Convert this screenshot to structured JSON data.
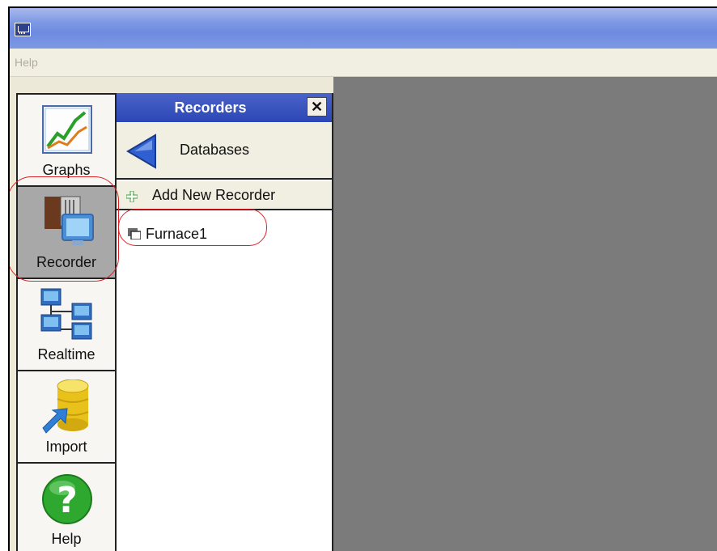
{
  "window": {
    "icon": "app-icon"
  },
  "menubar": {
    "items": [
      {
        "label": "Help"
      }
    ]
  },
  "toolbar": {
    "buttons": [
      {
        "label": "Graphs",
        "icon": "graph-chart-icon",
        "active": false
      },
      {
        "label": "Recorder",
        "icon": "recorder-monitor-icon",
        "active": true
      },
      {
        "label": "Realtime",
        "icon": "network-computers-icon",
        "active": false
      },
      {
        "label": "Import",
        "icon": "database-import-icon",
        "active": false
      },
      {
        "label": "Help",
        "icon": "help-question-icon",
        "active": false
      }
    ]
  },
  "panel": {
    "title": "Recorders",
    "close_symbol": "✕",
    "databases_label": "Databases",
    "add_label": "Add New Recorder",
    "tree": [
      {
        "label": "Furnace1",
        "icon": "recorder-node-icon"
      }
    ]
  },
  "colors": {
    "accent": "#2c47b5",
    "highlight": "#d8232a",
    "workspace": "#7b7b7b",
    "active_tool": "#a8a8a8"
  }
}
